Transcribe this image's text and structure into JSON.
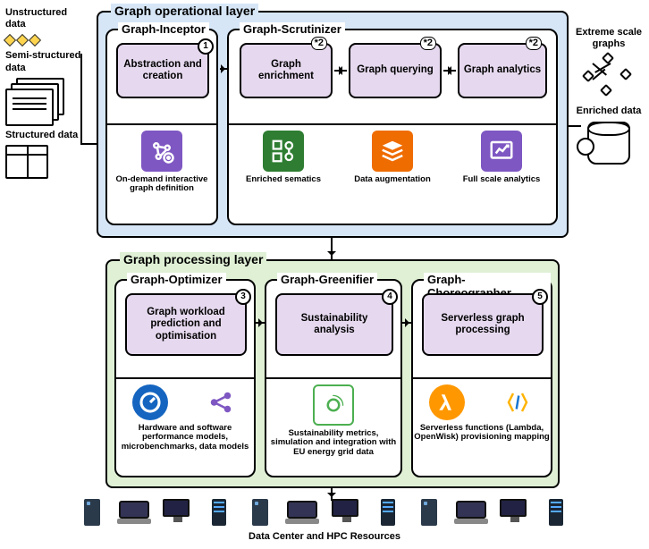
{
  "left": {
    "unstructured": "Unstructured data",
    "semi": "Semi-structured data",
    "structured": "Structured data"
  },
  "right": {
    "extreme": "Extreme scale graphs",
    "enriched": "Enriched data"
  },
  "op_layer": {
    "title": "Graph operational layer",
    "inceptor": {
      "title": "Graph-Inceptor",
      "box": "Abstraction and creation",
      "badge": "1",
      "caption": "On-demand interactive graph definition"
    },
    "scrutinizer": {
      "title": "Graph-Scrutinizer",
      "enrich": "Graph enrichment",
      "query": "Graph querying",
      "analytics": "Graph analytics",
      "badge": "*2",
      "cap1": "Enriched sematics",
      "cap2": "Data augmentation",
      "cap3": "Full scale analytics"
    }
  },
  "proc_layer": {
    "title": "Graph processing layer",
    "optimizer": {
      "title": "Graph-Optimizer",
      "box": "Graph workload prediction and optimisation",
      "badge": "3",
      "caption": "Hardware and software performance models, microbenchmarks, data models"
    },
    "greenifier": {
      "title": "Graph-Greenifier",
      "box": "Sustainability analysis",
      "badge": "4",
      "caption": "Sustainability metrics, simulation and integration with EU energy grid data"
    },
    "choreographer": {
      "title": "Graph-Choreographer",
      "box": "Serverless graph processing",
      "badge": "5",
      "caption": "Serverless functions (Lambda, OpenWisk) provisioning mapping"
    }
  },
  "hw_label": "Data Center and HPC Resources"
}
